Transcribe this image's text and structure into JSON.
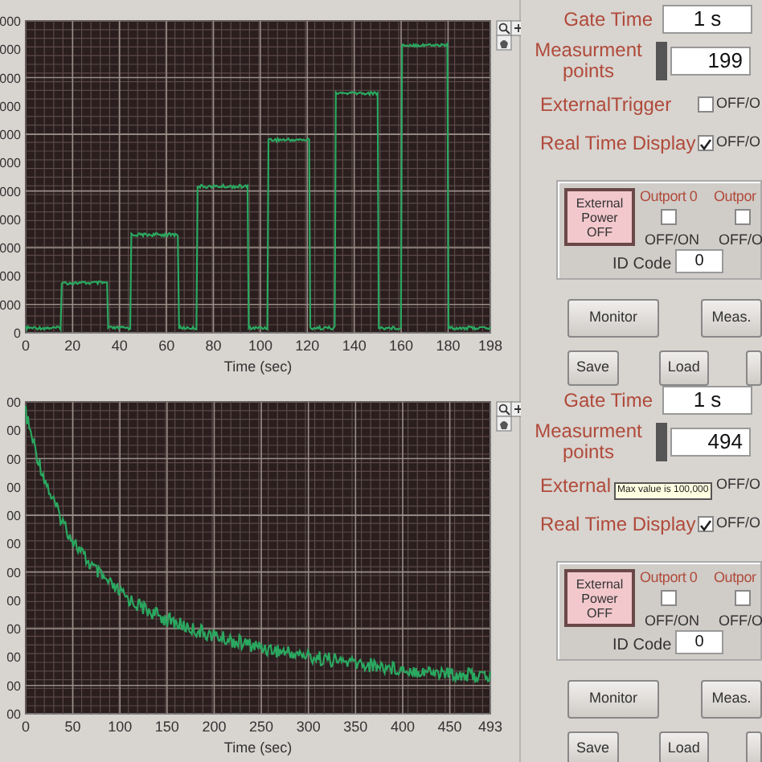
{
  "panels": [
    {
      "plot": {
        "kind": "steps",
        "x_title": "Time (sec)",
        "y_labels": [
          "000",
          "000",
          "000",
          "000",
          "000",
          "000",
          "000",
          "000",
          "000",
          "000",
          "000",
          "0"
        ],
        "x_ticks": [
          "0",
          "20",
          "40",
          "60",
          "80",
          "100",
          "120",
          "140",
          "160",
          "180",
          "198"
        ]
      },
      "gate_time": {
        "label": "Gate Time",
        "value": "1 s"
      },
      "measurement_points": {
        "label": "Measurment points",
        "value": "199"
      },
      "external_trigger": {
        "label": "ExternalTrigger",
        "checked": false,
        "option": "OFF/O"
      },
      "real_time_display": {
        "label": "Real Time Display",
        "checked": true,
        "option": "OFF/O"
      },
      "power_button": {
        "label": "External Power OFF"
      },
      "outports": [
        {
          "label": "Outport 0",
          "checked": false,
          "option": "OFF/ON"
        },
        {
          "label": "Outpor",
          "checked": false,
          "option": "OFF/O"
        }
      ],
      "id_code": {
        "label": "ID Code",
        "value": "0"
      },
      "buttons": [
        "Monitor",
        "Meas.",
        "Save",
        "Load"
      ]
    },
    {
      "plot": {
        "kind": "decay",
        "x_title": "Time (sec)",
        "y_labels": [
          "00",
          "00",
          "00",
          "00",
          "00",
          "00",
          "00",
          "00",
          "00",
          "00",
          "00",
          "00"
        ],
        "x_ticks": [
          "0",
          "50",
          "100",
          "150",
          "200",
          "250",
          "300",
          "350",
          "400",
          "450",
          "493"
        ]
      },
      "gate_time": {
        "label": "Gate Time",
        "value": "1 s"
      },
      "measurement_points": {
        "label": "Measurment points",
        "value": "494"
      },
      "external_trigger": {
        "label": "External",
        "option": "OFF/O"
      },
      "tooltip": "Max value is 100,000",
      "real_time_display": {
        "label": "Real Time Display",
        "checked": true,
        "option": "OFF/O"
      },
      "power_button": {
        "label": "External Power OFF"
      },
      "outports": [
        {
          "label": "Outport 0",
          "checked": false,
          "option": "OFF/ON"
        },
        {
          "label": "Outpor",
          "checked": false,
          "option": "OFF/O"
        }
      ],
      "id_code": {
        "label": "ID Code",
        "value": "0"
      },
      "buttons": [
        "Monitor",
        "Meas.",
        "Save",
        "Load"
      ]
    }
  ]
}
